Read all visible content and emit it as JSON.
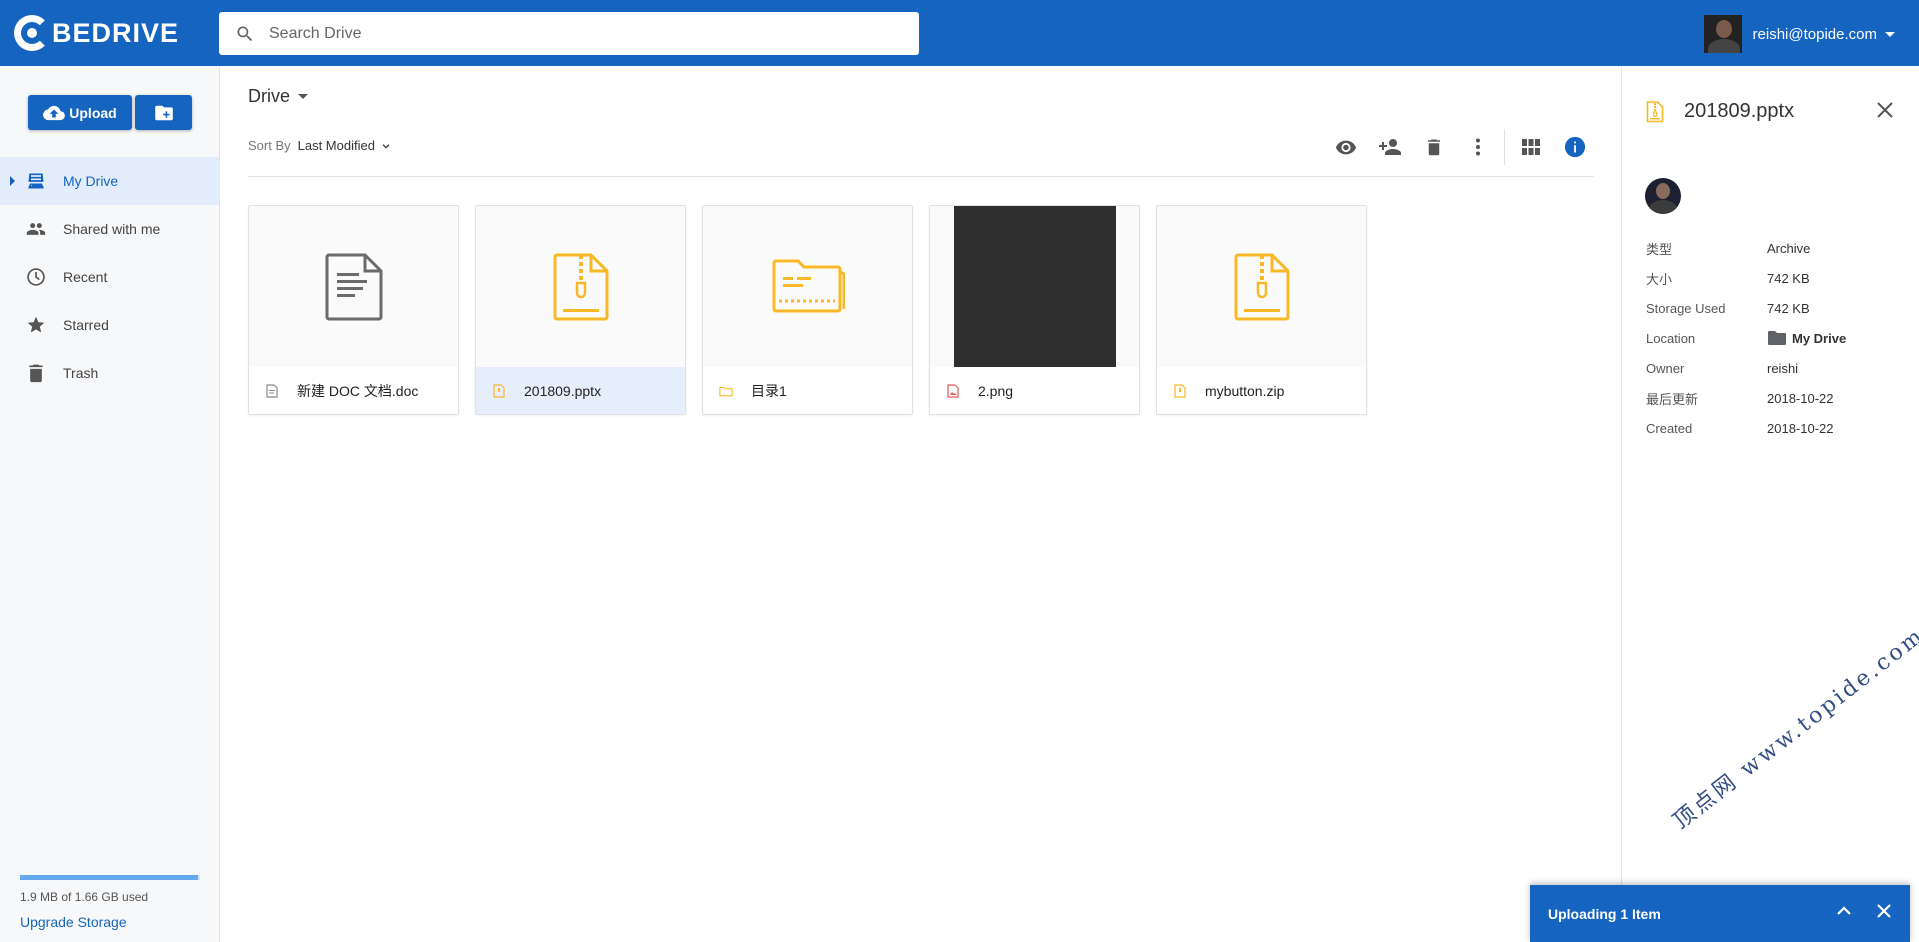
{
  "app": {
    "logo_text": "BEDRIVE"
  },
  "search": {
    "placeholder": "Search Drive"
  },
  "user": {
    "email": "reishi@topide.com"
  },
  "sidebar": {
    "upload_label": "Upload",
    "items": [
      {
        "label": "My Drive",
        "icon": "drive-icon",
        "active": true
      },
      {
        "label": "Shared with me",
        "icon": "people-icon",
        "active": false
      },
      {
        "label": "Recent",
        "icon": "clock-icon",
        "active": false
      },
      {
        "label": "Starred",
        "icon": "star-icon",
        "active": false
      },
      {
        "label": "Trash",
        "icon": "trash-icon",
        "active": false
      }
    ],
    "storage": {
      "text": "1.9 MB of 1.66 GB used",
      "upgrade_label": "Upgrade Storage",
      "used_fraction": 0.99
    }
  },
  "main": {
    "breadcrumb": "Drive",
    "sort": {
      "label": "Sort By",
      "value": "Last Modified"
    },
    "files": [
      {
        "name": "新建 DOC 文档.doc",
        "type": "document",
        "selected": false
      },
      {
        "name": "201809.pptx",
        "type": "archive",
        "selected": true
      },
      {
        "name": "目录1",
        "type": "folder",
        "selected": false
      },
      {
        "name": "2.png",
        "type": "image",
        "selected": false
      },
      {
        "name": "mybutton.zip",
        "type": "archive",
        "selected": false
      }
    ]
  },
  "details": {
    "title": "201809.pptx",
    "props": [
      {
        "key": "类型",
        "value": "Archive"
      },
      {
        "key": "大小",
        "value": "742 KB"
      },
      {
        "key": "Storage Used",
        "value": "742 KB"
      },
      {
        "key": "Location",
        "value": "My Drive"
      },
      {
        "key": "Owner",
        "value": "reishi"
      },
      {
        "key": "最后更新",
        "value": "2018-10-22"
      },
      {
        "key": "Created",
        "value": "2018-10-22"
      }
    ]
  },
  "upload_toast": {
    "label": "Uploading 1 Item"
  },
  "watermark": {
    "text": "顶点网 www.topide.com"
  },
  "colors": {
    "primary": "#1565c0",
    "archive": "#f9b825",
    "doc_gray": "#6b6b6b",
    "image_red": "#e05a4f"
  }
}
